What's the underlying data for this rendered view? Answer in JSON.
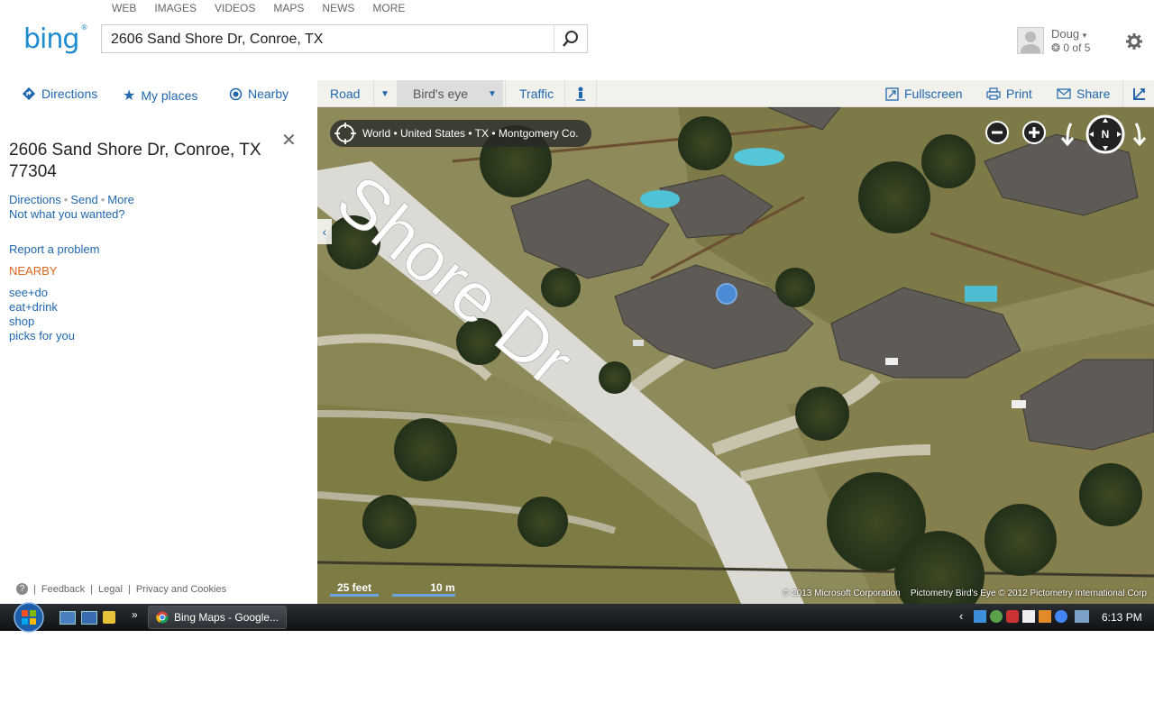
{
  "top_nav": [
    "WEB",
    "IMAGES",
    "VIDEOS",
    "MAPS",
    "NEWS",
    "MORE"
  ],
  "logo": "bing",
  "search": {
    "value": "2606 Sand Shore Dr, Conroe, TX"
  },
  "user": {
    "name": "Doug",
    "rewards": "0 of 5"
  },
  "left_tools": {
    "directions": "Directions",
    "my_places": "My places",
    "nearby": "Nearby"
  },
  "map_tools": {
    "road": "Road",
    "birds_eye": "Bird's eye",
    "traffic": "Traffic",
    "fullscreen": "Fullscreen",
    "print": "Print",
    "share": "Share"
  },
  "panel": {
    "address_line1": "2606 Sand Shore Dr, Conroe, TX",
    "address_line2": "77304",
    "actions": {
      "directions": "Directions",
      "send": "Send",
      "more": "More"
    },
    "not_wanted": "Not what you wanted?",
    "report": "Report a problem",
    "nearby_heading": "NEARBY",
    "nearby_links": [
      "see+do",
      "eat+drink",
      "shop",
      "picks for you"
    ],
    "footer": {
      "feedback": "Feedback",
      "legal": "Legal",
      "privacy": "Privacy and Cookies"
    }
  },
  "map": {
    "breadcrumb": "World • United States • TX • Montgomery Co.",
    "road_label": "Shore Dr",
    "scale_feet": "25 feet",
    "scale_m": "10 m",
    "copyright": "© 2013 Microsoft Corporation    Pictometry Bird's Eye © 2012 Pictometry International Corp"
  },
  "taskbar": {
    "window_title": "Bing Maps - Google...",
    "time": "6:13 PM"
  },
  "colors": {
    "bing_blue": "#1f8cd0",
    "link": "#2067ae",
    "nearby": "#d9651d",
    "location_dot": "#4a90e2"
  }
}
